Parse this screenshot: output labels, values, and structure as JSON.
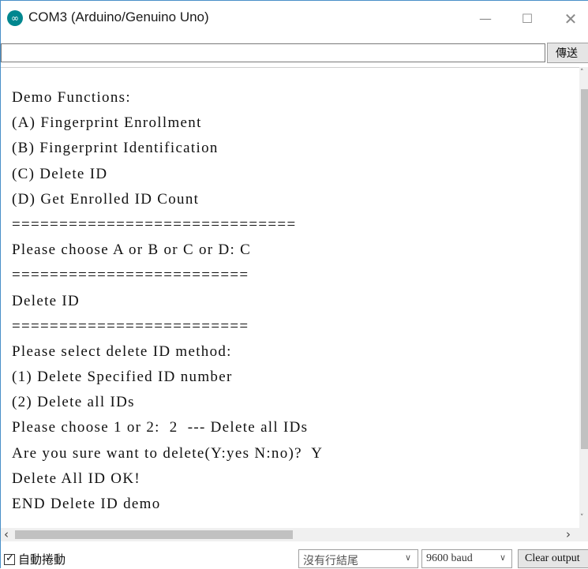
{
  "window": {
    "title": "COM3 (Arduino/Genuino Uno)",
    "icon": "arduino-infinity-icon",
    "controls": {
      "minimize": "—",
      "maximize": "☐",
      "close": "✕"
    }
  },
  "send_bar": {
    "input_value": "",
    "send_label": "傳送"
  },
  "output": {
    "lines": [
      "Demo Functions:",
      "(A) Fingerprint Enrollment",
      "(B) Fingerprint Identification",
      "(C) Delete ID",
      "(D) Get Enrolled ID Count",
      "==============================",
      "Please choose A or B or C or D: C",
      "=========================",
      "Delete ID",
      "=========================",
      "Please select delete ID method:",
      "(1) Delete Specified ID number",
      "(2) Delete all IDs",
      "Please choose 1 or 2:  2  --- Delete all IDs",
      "Are you sure want to delete(Y:yes N:no)?  Y",
      "Delete All ID OK!",
      "END Delete ID demo"
    ]
  },
  "status_bar": {
    "autoscroll_label": "自動捲動",
    "autoscroll_checked": true,
    "line_ending": "沒有行結尾",
    "baud_rate": "9600 baud",
    "clear_label": "Clear output"
  },
  "colors": {
    "accent_icon": "#00878f",
    "window_border": "#4a90c8",
    "scroll_thumb": "#c1c1c1"
  }
}
